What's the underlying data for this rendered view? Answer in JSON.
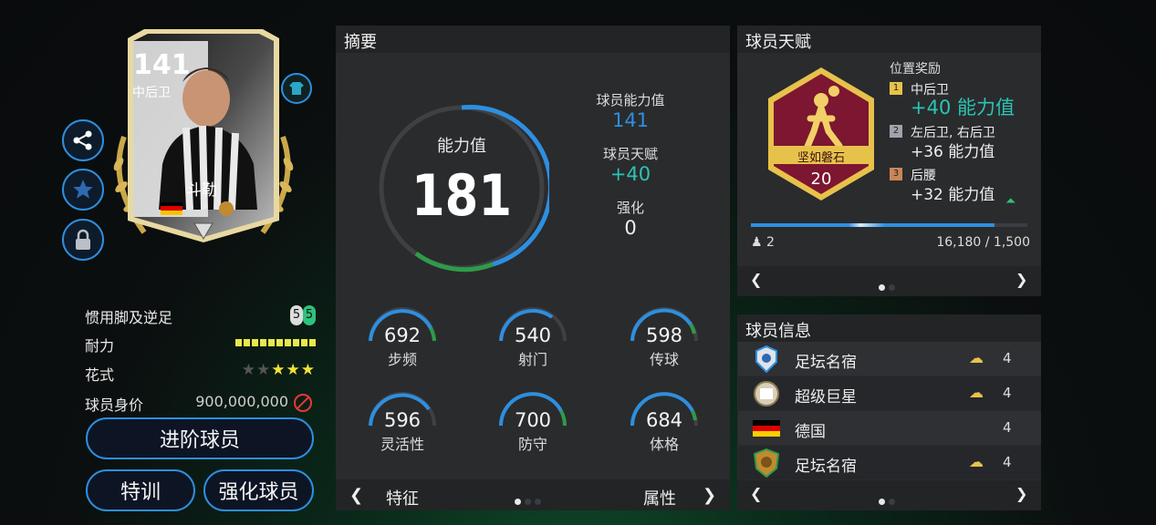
{
  "player": {
    "rating": "141",
    "position": "中后卫",
    "name": "斗勒",
    "flag": "germany-flag",
    "club_badge": "club-badge-icon"
  },
  "side_buttons": [
    "share-icon",
    "star-icon",
    "lock-icon"
  ],
  "attributes": [
    {
      "label": "惯用脚及逆足",
      "value": "5 5"
    },
    {
      "label": "耐力",
      "level": 10
    },
    {
      "label": "花式",
      "stars": 3,
      "max": 5
    },
    {
      "label": "球员身价",
      "value": "900,000,000"
    }
  ],
  "buttons": {
    "advance": "进阶球员",
    "train": "特训",
    "enhance": "强化球员"
  },
  "summary": {
    "title": "摘要",
    "ovr_label": "能力值",
    "ovr_value": "181",
    "player_ovr_label": "球员能力值",
    "player_ovr_value": "141",
    "talent_label": "球员天赋",
    "talent_value": "+40",
    "enhance_label": "强化",
    "enhance_value": "0",
    "stats": [
      {
        "value": "692",
        "name": "步频"
      },
      {
        "value": "540",
        "name": "射门"
      },
      {
        "value": "598",
        "name": "传球"
      },
      {
        "value": "596",
        "name": "灵活性"
      },
      {
        "value": "700",
        "name": "防守"
      },
      {
        "value": "684",
        "name": "体格"
      }
    ],
    "footer_left": "特征",
    "footer_right": "属性"
  },
  "talent": {
    "title": "球员天赋",
    "badge_name": "坚如磐石",
    "badge_level": "20",
    "bonus_title": "位置奖励",
    "bonuses": [
      {
        "rank": "1",
        "position": "中后卫",
        "value": "+40 能力值"
      },
      {
        "rank": "2",
        "position": "左后卫, 右后卫",
        "value": "+36 能力值"
      },
      {
        "rank": "3",
        "position": "后腰",
        "value": "+32 能力值"
      }
    ],
    "count": "2",
    "progress_text": "16,180 / 1,500",
    "progress": 0.88
  },
  "info": {
    "title": "球员信息",
    "rows": [
      {
        "icon": "legend-badge-icon",
        "label": "足坛名宿",
        "num": "4"
      },
      {
        "icon": "superstar-badge-icon",
        "label": "超级巨星",
        "num": "4"
      },
      {
        "icon": "germany-flag",
        "label": "德国",
        "num": "4"
      },
      {
        "icon": "club-legend-badge-icon",
        "label": "足坛名宿",
        "num": "4"
      }
    ]
  },
  "colors": {
    "accent": "#2d8fe0",
    "green": "#2ec27e",
    "teal": "#29c5b5",
    "stamina": "#e7e84a"
  }
}
